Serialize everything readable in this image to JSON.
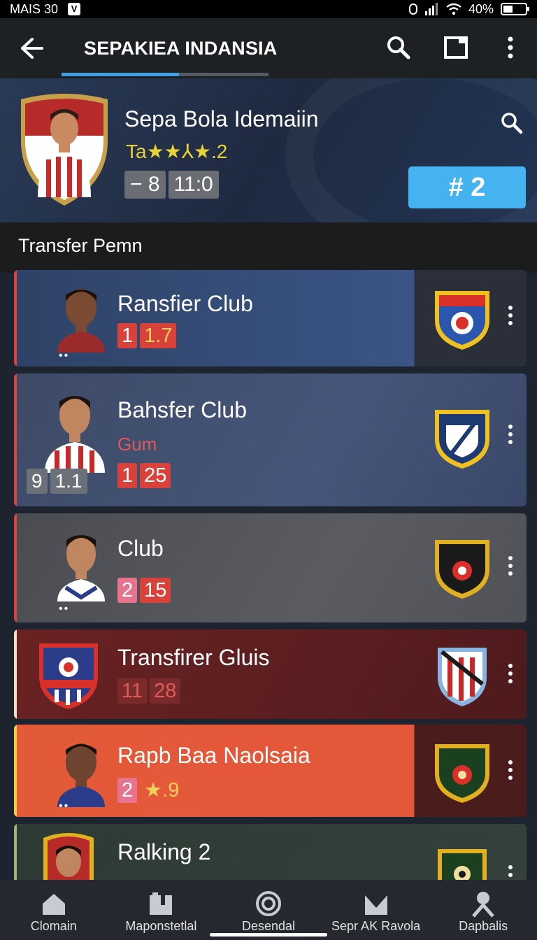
{
  "status_bar": {
    "time": "MAIS 30",
    "battery": "40%"
  },
  "app_bar": {
    "title": "SEPAKIEA INDANSIA"
  },
  "hero": {
    "name": "Sepa Bola Idemaiin",
    "rating": "Ta★★⅄★.2",
    "stats": [
      "− 8",
      "11:0"
    ],
    "action_label": "# 2"
  },
  "section": {
    "title": "Transfer Pemn"
  },
  "rows": [
    {
      "title": "Ransfier Club",
      "badge1": "1",
      "badge2": "1.7",
      "dots": "••"
    },
    {
      "title": "Bahsfer Club",
      "subtitle": "Gum",
      "badge1": "1",
      "badge2": "25",
      "level": [
        "9",
        "1.1"
      ]
    },
    {
      "title": "Club",
      "badge1": "2",
      "badge2": "15",
      "dots": "••"
    },
    {
      "title": "Transfirer Gluis",
      "badge1": "11",
      "badge2": "28"
    },
    {
      "title": "Rapb Baa Naolsaia",
      "badge1": "2",
      "badge2": "★.9",
      "dots": "••"
    },
    {
      "title": "Ralking 2",
      "badge1": "",
      "badge2": ""
    }
  ],
  "nav": [
    {
      "label": "Clomain",
      "icon": "home-icon"
    },
    {
      "label": "Maponstetlal",
      "icon": "board-icon"
    },
    {
      "label": "Desendal",
      "icon": "target-icon"
    },
    {
      "label": "Sepr AK Ravola",
      "icon": "chart-icon"
    },
    {
      "label": "Dapbalis",
      "icon": "person-icon"
    }
  ],
  "colors": {
    "accent": "#44b3ef",
    "tab_active": "#3fa0e4",
    "badge_red": "#d9423a",
    "row_orange": "#e35a38"
  }
}
